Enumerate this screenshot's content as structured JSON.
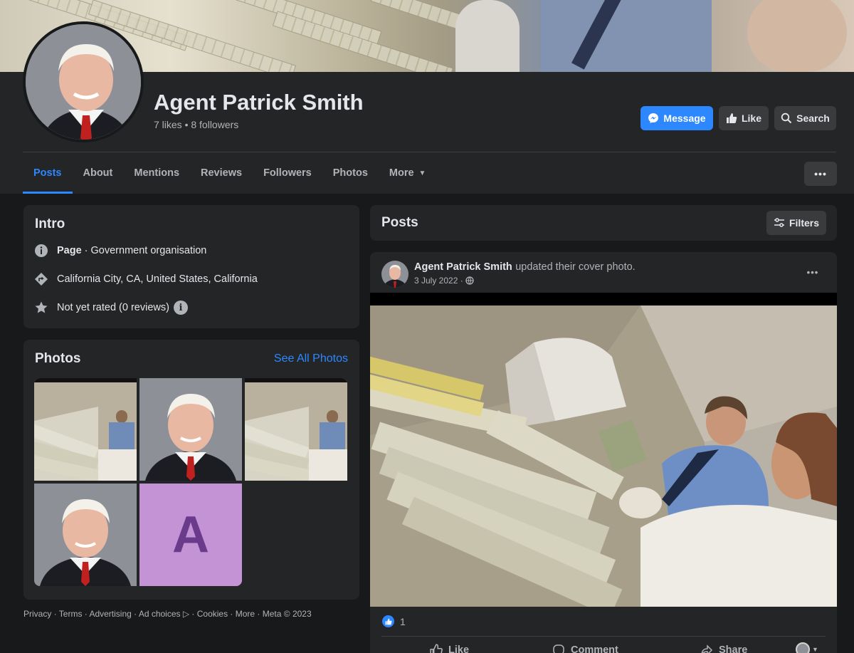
{
  "profile": {
    "name": "Agent Patrick Smith",
    "stats": "7 likes • 8 followers"
  },
  "actions": {
    "message": "Message",
    "like": "Like",
    "search": "Search"
  },
  "tabs": [
    "Posts",
    "About",
    "Mentions",
    "Reviews",
    "Followers",
    "Photos",
    "More"
  ],
  "more_options": "•••",
  "intro": {
    "title": "Intro",
    "category_label": "Page",
    "category_value": "· Government organisation",
    "location": "California City, CA, United States, California",
    "rating": "Not yet rated (0 reviews)",
    "info_glyph": "i"
  },
  "photos": {
    "title": "Photos",
    "see_all": "See All Photos",
    "placeholder_letter": "A"
  },
  "footer": "Privacy · Terms · Advertising · Ad choices ▷ · Cookies · More · Meta © 2023",
  "posts": {
    "title": "Posts",
    "filters": "Filters",
    "post": {
      "author": "Agent Patrick Smith",
      "action": "updated their cover photo.",
      "date": "3 July 2022 ·",
      "reactions": "1",
      "like": "Like",
      "comment": "Comment",
      "share": "Share"
    }
  },
  "colors": {
    "accent": "#2d88ff",
    "background": "#18191a",
    "card": "#242526",
    "placeholder_bg": "#c393d6",
    "placeholder_fg": "#6a3a8b"
  }
}
